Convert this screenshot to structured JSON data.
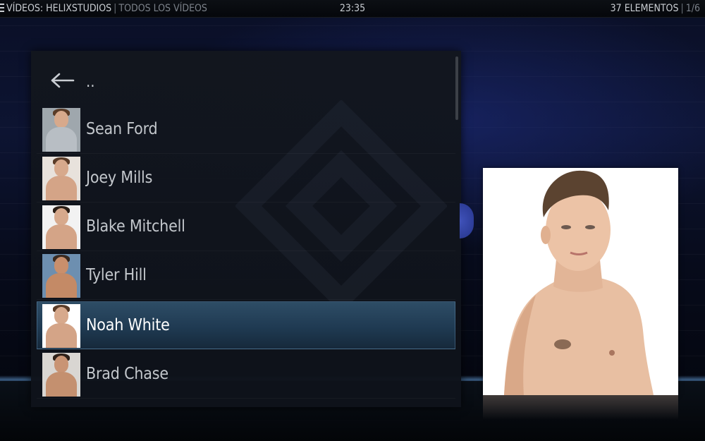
{
  "header": {
    "section": "VÍDEOS: HELIXSTUDIOS",
    "subsection": "TODOS LOS VÍDEOS",
    "separator": "|",
    "clock": "23:35",
    "item_count": "37 ELEMENTOS",
    "page": "1/6"
  },
  "list": {
    "parent_label": "..",
    "items": [
      {
        "label": "Sean Ford",
        "thumb_bg": "#9fa7ad",
        "shirt": "#b8bec4"
      },
      {
        "label": "Joey Mills",
        "thumb_bg": "#e8e2dc",
        "shirt": ""
      },
      {
        "label": "Blake Mitchell",
        "thumb_bg": "#f2f2f2",
        "shirt": ""
      },
      {
        "label": "Tyler Hill",
        "thumb_bg": "#6d8fb0",
        "shirt": ""
      },
      {
        "label": "Noah White",
        "thumb_bg": "#ffffff",
        "shirt": "",
        "selected": true
      },
      {
        "label": "Brad Chase",
        "thumb_bg": "#d9d6d2",
        "shirt": ""
      }
    ]
  },
  "colors": {
    "selection_top": "#2e4d66",
    "selection_bottom": "#16293b",
    "accent_glow": "#64a0dc"
  },
  "icons": {
    "back": "arrow-left-icon",
    "menu": "menu-icon"
  }
}
